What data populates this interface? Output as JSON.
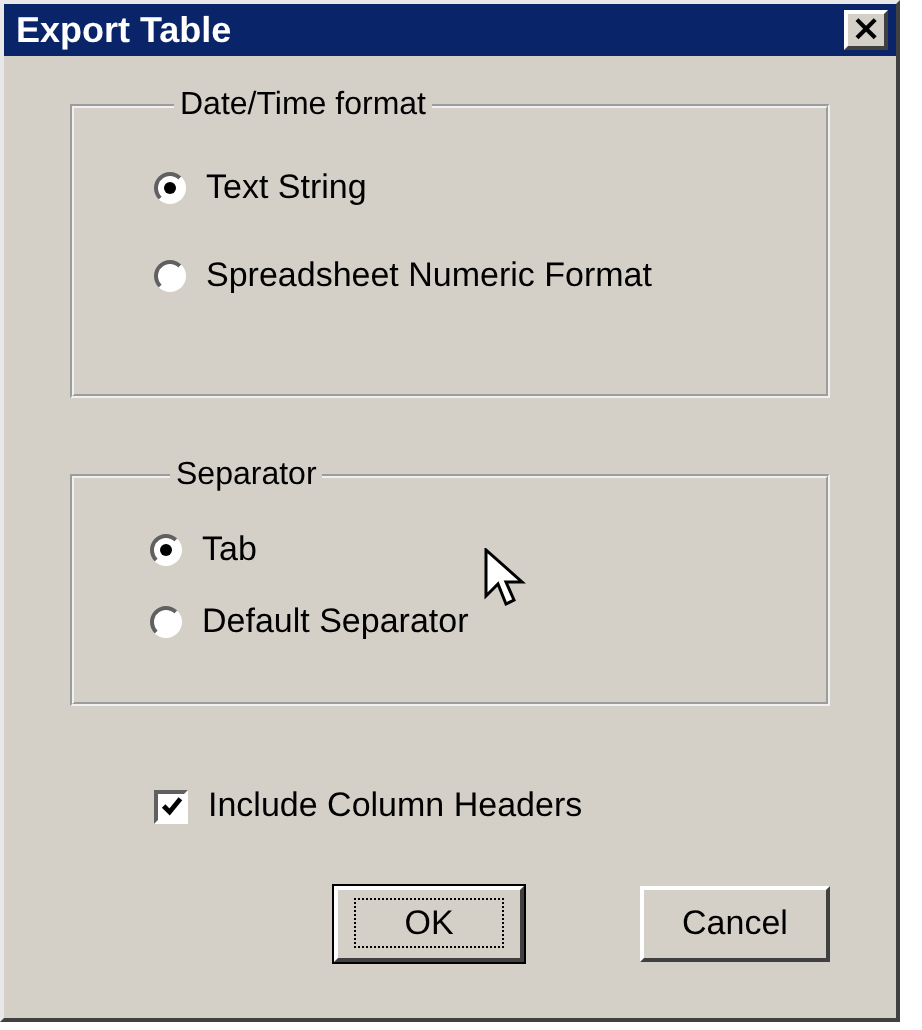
{
  "window": {
    "title": "Export Table",
    "close": "×"
  },
  "groups": [
    {
      "title": "Date/Time format",
      "options": [
        {
          "label": "Text String",
          "selected": true
        },
        {
          "label": "Spreadsheet Numeric Format",
          "selected": false
        }
      ]
    },
    {
      "title": "Separator",
      "options": [
        {
          "label": "Tab",
          "selected": true
        },
        {
          "label": "Default Separator",
          "selected": false
        }
      ]
    }
  ],
  "checkbox": {
    "label": "Include Column Headers",
    "checked": true
  },
  "buttons": [
    {
      "label": "OK",
      "default": true
    },
    {
      "label": "Cancel",
      "default": false
    }
  ]
}
